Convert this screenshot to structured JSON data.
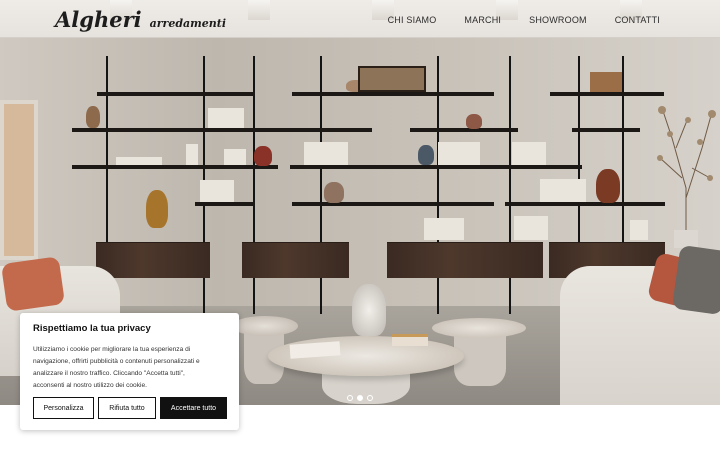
{
  "header": {
    "logo_main": "Algheri",
    "logo_sub": "arredamenti",
    "nav": [
      {
        "label": "CHI SIAMO"
      },
      {
        "label": "MARCHI"
      },
      {
        "label": "SHOWROOM"
      },
      {
        "label": "CONTATTI"
      }
    ]
  },
  "hero": {
    "slides_total": 3,
    "active_slide": 2
  },
  "cookie": {
    "title": "Rispettiamo la tua privacy",
    "text_lines": [
      "Utilizziamo i cookie per migliorare la tua esperienza di",
      "navigazione, offrirti pubblicità o contenuti personalizzati e",
      "analizzare il nostro traffico. Cliccando \"Accetta tutti\",",
      "acconsenti al nostro utilizzo dei cookie."
    ],
    "customize_label": "Personalizza",
    "reject_label": "Rifiuta tutto",
    "accept_label": "Accettare tutto"
  },
  "colors": {
    "accent_dark": "#111111",
    "cushion_terracotta": "#c46a4c",
    "cabinet_wood": "#4e382c"
  }
}
